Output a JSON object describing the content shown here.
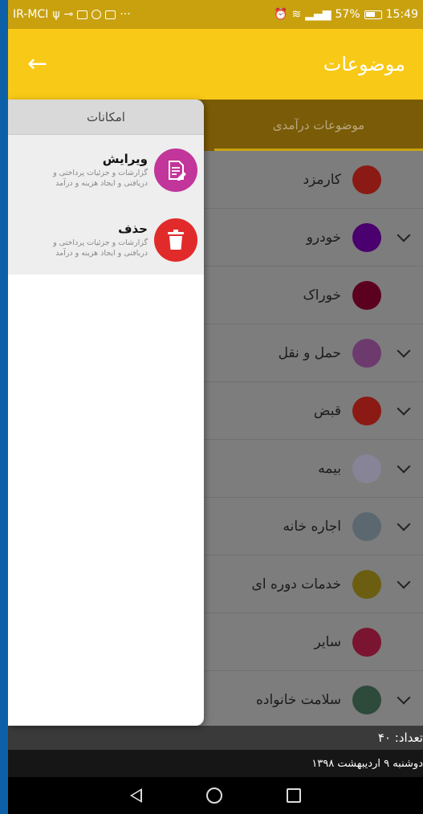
{
  "status_bar": {
    "carrier": "IR-MCI",
    "battery_percent": "57%",
    "time": "15:49"
  },
  "app_bar": {
    "title": "موضوعات",
    "back_icon": "arrow-left-icon"
  },
  "tabs": [
    {
      "label": "موضوعات درآمدی"
    }
  ],
  "list": {
    "items": [
      {
        "label": "کارمزد",
        "color": "#8b1a14",
        "expandable": false
      },
      {
        "label": "خودرو",
        "color": "#4a006e",
        "expandable": true
      },
      {
        "label": "خوراک",
        "color": "#5c0020",
        "expandable": false
      },
      {
        "label": "حمل و نقل",
        "color": "#6d3a6e",
        "expandable": true
      },
      {
        "label": "قبض",
        "color": "#8b1a14",
        "expandable": true
      },
      {
        "label": "بیمه",
        "color": "#888497",
        "expandable": true
      },
      {
        "label": "اجاره خانه",
        "color": "#5b6870",
        "expandable": true
      },
      {
        "label": "خدمات دوره ای",
        "color": "#6b5e10",
        "expandable": true
      },
      {
        "label": "سایر",
        "color": "#7a1430",
        "expandable": false
      },
      {
        "label": "سلامت خانواده",
        "color": "#2e4a3a",
        "expandable": true
      }
    ]
  },
  "footer": {
    "count_text": "تعداد: ۴۰",
    "date_text": "دوشنبه ۹ اردیبهشت ۱۳۹۸"
  },
  "popup": {
    "title": "امکانات",
    "options": [
      {
        "title": "ویرایش",
        "desc_line1": "گزارشات و جزئیات پرداختی و",
        "desc_line2": "دریافتی و ایجاد هزینه و درآمد",
        "icon": "edit-document-icon",
        "color": "#c2359a"
      },
      {
        "title": "حذف",
        "desc_line1": "گزارشات و جزئیات پرداختی و",
        "desc_line2": "دریافتی و ایجاد هزینه و درآمد",
        "icon": "trash-icon",
        "color": "#e12b2b"
      }
    ]
  }
}
